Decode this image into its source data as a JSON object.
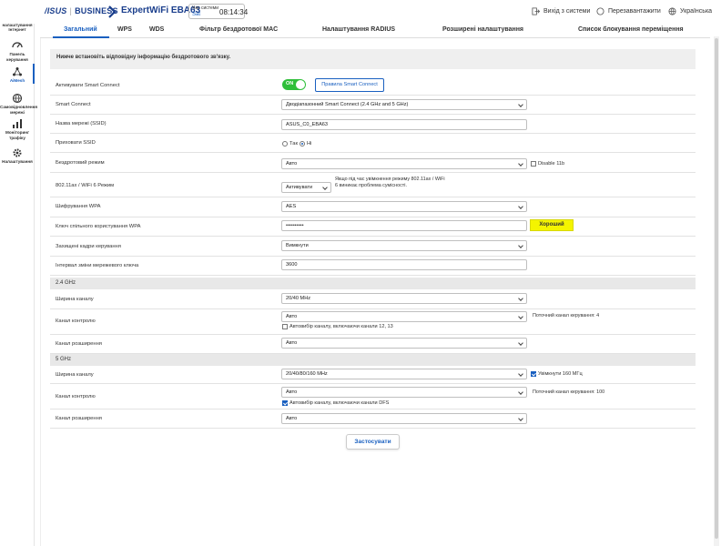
{
  "header": {
    "brand": "/ISUS",
    "brand_suffix": "BUSINESS",
    "model": "ExpertWiFi EBA63",
    "time_label": "Час системи",
    "day": "Sat",
    "time": "08:14:34",
    "logout": "Вихід з системи",
    "reboot": "Перезавантажити",
    "language": "Українська"
  },
  "sidebar": {
    "items": [
      {
        "label": "Швидке налаштування Інтернет",
        "icon": "wand-icon"
      },
      {
        "label": "Панель керування",
        "icon": "dashboard-icon"
      },
      {
        "label": "AiMesh",
        "icon": "mesh-icon"
      },
      {
        "label": "Самовідновлення мережі",
        "icon": "network-icon"
      },
      {
        "label": "Моніторинг трафіку",
        "icon": "traffic-icon"
      },
      {
        "label": "Налаштування",
        "icon": "gear-icon"
      }
    ]
  },
  "tabs": [
    "Загальний",
    "WPS",
    "WDS",
    "Фільтр бездротової MAC",
    "Налаштування RADIUS",
    "Розширені налаштування",
    "Список блокування переміщення"
  ],
  "info": "Нижче встановіть відповідну інформацію бездротового зв'язку.",
  "form": {
    "smart_connect_label": "Активувати Smart Connect",
    "smart_connect_state": "ON",
    "smart_connect_rules": "Правила Smart Connect",
    "smart_connect_mode_label": "Smart Connect",
    "smart_connect_mode": "Дводіапазонний Smart Connect (2.4 GHz and 5 GHz)",
    "ssid_label": "Назва мережі (SSID)",
    "ssid": "ASUS_C0_EBA63",
    "hide_ssid_label": "Приховати SSID",
    "hide_yes": "Так",
    "hide_no": "Ні",
    "wireless_mode_label": "Бездротовий режим",
    "wireless_mode": "Авто",
    "disable_11b": "Disable 11b",
    "ax_label": "802.11ax / WiFi 6 Режим",
    "ax_value": "Активувати",
    "ax_note": "Якщо під час увімкнення режиму 802.11ax / WiFi 6 виникає проблема сумісності.",
    "wpa_enc_label": "Шифрування WPA",
    "wpa_enc": "AES",
    "wpa_key_label": "Ключ спільного користування WPA",
    "wpa_key": "••••••••••",
    "strength": "Хороший",
    "pmf_label": "Захищені кадри керування",
    "pmf": "Вимкнути",
    "gtk_label": "Інтервал зміни мережевого ключа",
    "gtk": "3600"
  },
  "band24": {
    "title": "2.4 GHz",
    "bw_label": "Ширина каналу",
    "bw": "20/40 MHz",
    "ctrl_label": "Канал контролю",
    "ctrl": "Авто",
    "current": "Поточний канал керування: 4",
    "auto_chk": "Автовибір каналу, включаючи канали 12, 13",
    "ext_label": "Канал розширення",
    "ext": "Авто"
  },
  "band5": {
    "title": "5 GHz",
    "bw_label": "Ширина каналу",
    "bw": "20/40/80/160 MHz",
    "enable160": "Увімкнути 160 МГц",
    "ctrl_label": "Канал контролю",
    "ctrl": "Авто",
    "current": "Поточний канал керування: 100",
    "auto_chk": "Автовибір каналу, включаючи канали DFS",
    "ext_label": "Канал розширення",
    "ext": "Авто"
  },
  "apply": "Застосувати",
  "colors": {
    "accent": "#1a60c0",
    "toggle_on": "#2fbf3a",
    "strength": "#f4f400"
  }
}
